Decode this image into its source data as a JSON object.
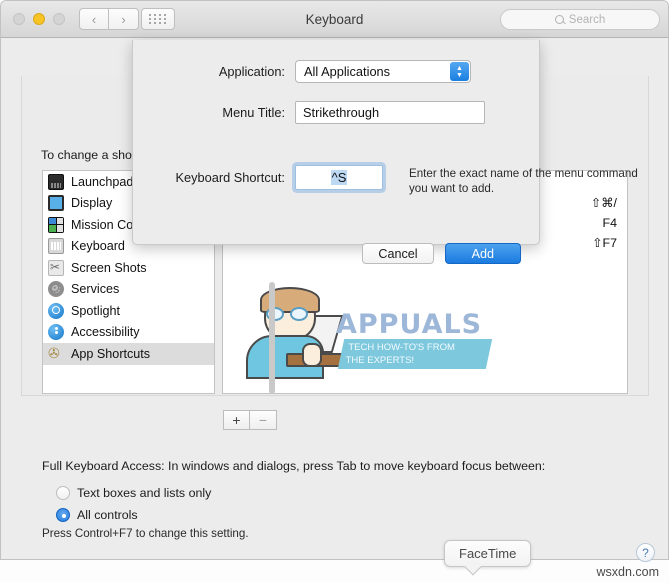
{
  "window": {
    "title": "Keyboard",
    "search_placeholder": "Search",
    "nav_back": "‹",
    "nav_forward": "›"
  },
  "pane": {
    "hint": "To change a shortcut, select it, click the key combination, and then type the new keys.",
    "categories": [
      {
        "label": "Launchpad & Dock",
        "icon": "launchpad-icon",
        "selected": false
      },
      {
        "label": "Display",
        "icon": "display-icon",
        "selected": false
      },
      {
        "label": "Mission Control",
        "icon": "mission-control-icon",
        "selected": false
      },
      {
        "label": "Keyboard",
        "icon": "keyboard-icon",
        "selected": false
      },
      {
        "label": "Screen Shots",
        "icon": "screenshot-icon",
        "selected": false
      },
      {
        "label": "Services",
        "icon": "services-icon",
        "selected": false
      },
      {
        "label": "Spotlight",
        "icon": "spotlight-icon",
        "selected": false
      },
      {
        "label": "Accessibility",
        "icon": "accessibility-icon",
        "selected": false
      },
      {
        "label": "App Shortcuts",
        "icon": "app-shortcuts-icon",
        "selected": true
      }
    ],
    "shortcut_keys": [
      "⇧⌘/",
      "F4",
      "⇧F7"
    ],
    "add_button": "+",
    "remove_button": "−",
    "watermark": {
      "word": "APPUALS",
      "line1": "TECH HOW-TO'S FROM",
      "line2": "THE EXPERTS!"
    }
  },
  "full_keyboard_access": {
    "label": "Full Keyboard Access: In windows and dialogs, press Tab to move keyboard focus between:",
    "options": [
      {
        "label": "Text boxes and lists only",
        "selected": false
      },
      {
        "label": "All controls",
        "selected": true
      }
    ],
    "note": "Press Control+F7 to change this setting."
  },
  "sheet": {
    "application_label": "Application:",
    "application_value": "All Applications",
    "menu_title_label": "Menu Title:",
    "menu_title_value": "Strikethrough",
    "menu_title_help": "Enter the exact name of the menu command you want to add.",
    "shortcut_label": "Keyboard Shortcut:",
    "shortcut_value": "^S",
    "cancel_label": "Cancel",
    "add_label": "Add"
  },
  "footer": {
    "tooltip": "FaceTime",
    "help": "?",
    "site_watermark": "wsxdn.com"
  },
  "colors": {
    "accent": "#1a7be0",
    "selection": "#bcd8f2",
    "row_selected": "#dcdcdc"
  }
}
